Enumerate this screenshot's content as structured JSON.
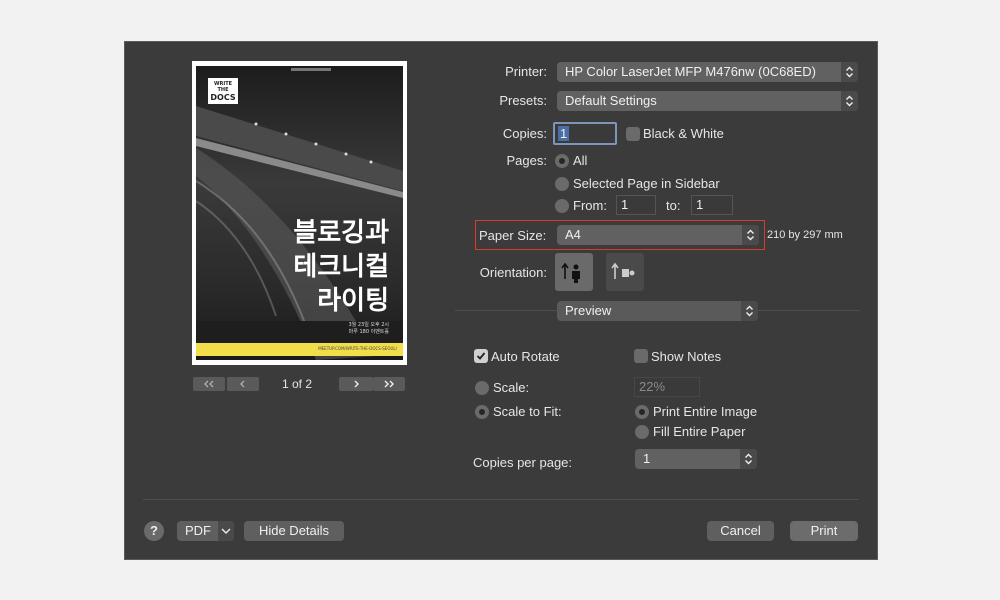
{
  "preview": {
    "logo_line1": "WRITE THE",
    "logo_line2": "DOCS",
    "title_line1": "블로깅과",
    "title_line2": "테크니컬",
    "title_line3": "라이팅",
    "date_line1": "3월 23일 오후 2시",
    "date_line2": "마루 180 이벤트홀",
    "footer_text": "MEETUP.COM/WRITE-THE-DOCS-SEOUL/",
    "accent_color": "#f1de4a"
  },
  "pager": {
    "first_icon": "double-chevron-left-icon",
    "prev_icon": "chevron-left-icon",
    "next_icon": "chevron-right-icon",
    "last_icon": "double-chevron-right-icon",
    "page_label": "1 of 2"
  },
  "form": {
    "printer_label": "Printer:",
    "printer_value": "HP Color LaserJet MFP M476nw (0C68ED)",
    "presets_label": "Presets:",
    "presets_value": "Default Settings",
    "copies_label": "Copies:",
    "copies_value": "1",
    "bw_label": "Black & White",
    "pages_label": "Pages:",
    "pages_all": "All",
    "pages_selected": "Selected Page in Sidebar",
    "pages_from": "From:",
    "from_value": "1",
    "pages_to": "to:",
    "to_value": "1",
    "paper_size_label": "Paper Size:",
    "paper_size_value": "A4",
    "paper_size_dims": "210 by 297 mm",
    "highlight_color": "#d93a2b",
    "orientation_label": "Orientation:",
    "section_value": "Preview",
    "auto_rotate": "Auto Rotate",
    "show_notes": "Show Notes",
    "scale_label": "Scale:",
    "scale_value": "22%",
    "scale_to_fit": "Scale to Fit:",
    "print_entire": "Print Entire Image",
    "fill_paper": "Fill Entire Paper",
    "copies_per_page_label": "Copies per page:",
    "copies_per_page_value": "1"
  },
  "footer": {
    "help": "?",
    "pdf": "PDF",
    "hide_details": "Hide Details",
    "cancel": "Cancel",
    "print": "Print"
  }
}
